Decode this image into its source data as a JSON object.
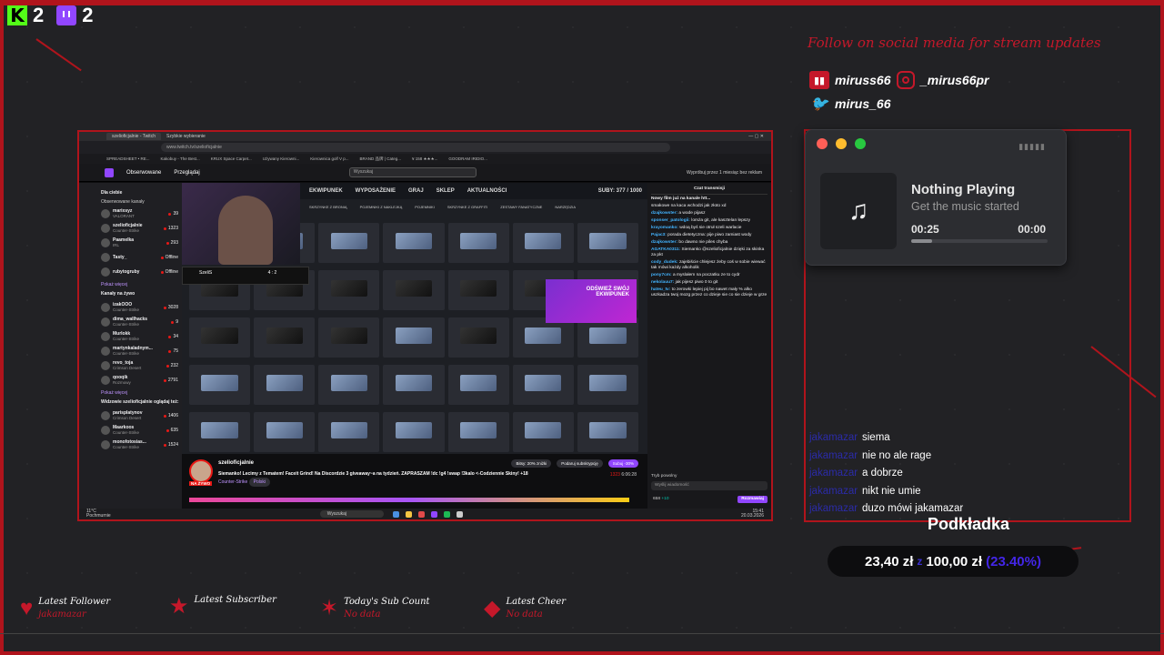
{
  "counters": {
    "kick": {
      "letter": "K",
      "value": "2"
    },
    "twitch": {
      "value": "2"
    }
  },
  "social": {
    "headline": "Follow on social media for stream updates",
    "twitch": "miruss66",
    "instagram": "_mirus66pr",
    "twitter": "mirus_66"
  },
  "browser": {
    "tabs": [
      "szelioficjalnie - Twitch",
      "Szybkie wybieranie"
    ],
    "url": "www.twitch.tv/szelioficjalnie",
    "bookmarks": [
      "SPREADSHEET • RE...",
      "Kakobuy - The Best...",
      "KRUX Space Carpet...",
      "Używany Kierowni...",
      "Kierownica golf V p...",
      "BRAND 品牌 | Categ...",
      "¥ 158 ★★★...",
      "GOODRAM IRIDIO..."
    ]
  },
  "twitch": {
    "nav": {
      "following": "Obserwowane",
      "browse": "Przeglądaj",
      "search_placeholder": "Wyszukaj",
      "promo": "Wypróbuj przez 1 miesiąc bez reklam"
    },
    "sidebar": {
      "for_you": "Dla ciebie",
      "followed_header": "Obserwowane kanały",
      "followed": [
        {
          "name": "marixsyz",
          "game": "VALORANT",
          "viewers": "39"
        },
        {
          "name": "szelioficjalnie",
          "game": "Counter-Strike",
          "viewers": "1323"
        },
        {
          "name": "Paamelka",
          "game": "IRL",
          "viewers": "293"
        },
        {
          "name": "Tasty_",
          "game": "",
          "viewers": "Offline"
        },
        {
          "name": "rubytogruby",
          "game": "",
          "viewers": "Offline"
        }
      ],
      "show_more": "Pokaż więcej",
      "live_header": "Kanały na żywo",
      "live": [
        {
          "name": "izakOOO",
          "game": "Counter-Strike",
          "viewers": "3028"
        },
        {
          "name": "dima_wallhacks",
          "game": "Counter-Strike",
          "viewers": "9"
        },
        {
          "name": "Murlokk",
          "game": "Counter-Strike",
          "viewers": "34"
        },
        {
          "name": "martynkaladnym...",
          "game": "Counter-Strike",
          "viewers": "75"
        },
        {
          "name": "revo_toja",
          "game": "Crimson Desert",
          "viewers": "232"
        },
        {
          "name": "qooqik",
          "game": "Rozmowy",
          "viewers": "2791"
        }
      ],
      "show_more2": "Pokaż więcej",
      "viewers_header": "Widzowie szelioficjalnie oglądaj też:",
      "viewers_also": [
        {
          "name": "parisplatynov",
          "game": "Crimson Desert",
          "viewers": "1406"
        },
        {
          "name": "Maarkoos",
          "game": "Counter-Strike",
          "viewers": "635"
        },
        {
          "name": "monofotosias...",
          "game": "Counter-Strike",
          "viewers": "1524"
        }
      ]
    },
    "game_ui": {
      "tabs": [
        "EKWIPUNEK",
        "WYPOSAŻENIE",
        "GRAJ",
        "SKLEP",
        "AKTUALNOŚCI"
      ],
      "suby": "SUBY: 377 / 1000",
      "categories": [
        "SKRZYNKE Z BRONIĄ",
        "POJEMNIKI Z NAKLEJKĄ",
        "POJEMNIKI",
        "SKRZYNKE Z GRAFFITI",
        "ZESTAWY FANATYCZNE",
        "NARZĘDZIA"
      ],
      "refresh_banner": "ODŚWIEŻ SWÓJ EKWIPUNEK",
      "scoreboard_name": "SzeliS",
      "scoreboard_score": "4 : 2"
    },
    "stream": {
      "channel": "szelioficjalnie",
      "live": "NA ŻYWO",
      "title": "Siemanko! Lecimy z Tematem! Faceit Grind! Na Discordzie 3 giveaway~a na tydzień. ZAPRASZAM !dc !g4 !swap !3kalo <-Codziennie Skiny! +18",
      "game": "Counter-Strike",
      "tag": "Polski",
      "bits": "Bitsy: 20% zniżki",
      "gift": "Podaruj subskrypcję",
      "subscribe": "Subuj -30%",
      "viewers": "1323",
      "uptime": "6:06:28"
    },
    "chat": {
      "header": "Czat transmisji",
      "pinned": "Nowy film już na kanale htt...",
      "messages": [
        {
          "user": "",
          "text": "smakowe na kaca wchodzi jak złoto xd"
        },
        {
          "user": "dzajkowster:",
          "text": "a wode pijasz"
        },
        {
          "user": "sponser_patologii:",
          "text": "lomża git, ale kasztelan lepszy"
        },
        {
          "user": "krayomanko:",
          "text": "wdoą byś sie otruł szeli warlacie"
        },
        {
          "user": "Pajac3:",
          "text": "poradа dietetyczna: pije piwo zamiast wody"
        },
        {
          "user": "dzajkowster:",
          "text": "bo dawno nie piles chyba"
        },
        {
          "user": "AGATKA0311:",
          "text": "Siemanko @szelioficjalnie dzięki za skinka za pkt"
        },
        {
          "user": "cody_dudek:",
          "text": "zajebiście chlejesz żeby coś w sobie wiewać tak mówi każdy alkoholik"
        },
        {
          "user": "pony7cm:",
          "text": "a myslałem na poczatku ze to cydr"
        },
        {
          "user": "nekolauu7:",
          "text": "jak pijesz piwo 0 to git"
        },
        {
          "user": "hateu_tv:",
          "text": "to zerowki lepiej pij bo nawet mały % alko uszkadza twoj mozg przez co dzieje sie co sie dzieje w grze"
        }
      ],
      "mode": "Tryb powolny",
      "input_placeholder": "Wyślij wiadomość",
      "points": "658",
      "points_plus": "+10",
      "send": "Rozmawiaj"
    },
    "taskbar": {
      "weather": "11°C",
      "weather_sub": "Pochmurnie",
      "search": "Wyszukaj",
      "time": "15:41",
      "date": "20.03.2026"
    }
  },
  "music": {
    "title": "Nothing Playing",
    "subtitle": "Get the music started",
    "current": "00:25",
    "total": "00:00",
    "progress": 0.15
  },
  "overlay_chat": [
    {
      "user": "jakamazar",
      "text": "siema"
    },
    {
      "user": "jakamazar",
      "text": "nie no ale rage"
    },
    {
      "user": "jakamazar",
      "text": "a dobrze"
    },
    {
      "user": "jakamazar",
      "text": "nikt nie umie"
    },
    {
      "user": "jakamazar",
      "text": "duzo mówi jakamazar"
    }
  ],
  "goal": {
    "title": "Podkładka",
    "current": "23,40 zł",
    "separator": "z",
    "target": "100,00 zł",
    "percent": "(23.40%)"
  },
  "alerts": {
    "follower": {
      "label": "Latest Follower",
      "value": "jakamazar"
    },
    "subscriber": {
      "label": "Latest Subscriber",
      "value": ""
    },
    "subcount": {
      "label": "Today's Sub Count",
      "value": "No data"
    },
    "cheer": {
      "label": "Latest Cheer",
      "value": "No data"
    }
  },
  "colors": {
    "accent": "#b0141c",
    "kick": "#53fc18",
    "twitch": "#9146ff",
    "goal_pct": "#4326e8"
  }
}
